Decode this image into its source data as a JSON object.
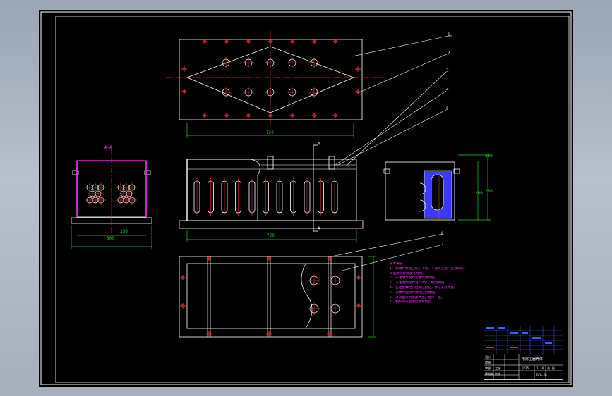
{
  "colors": {
    "background": "#a6b0bd",
    "sheet": "#000000",
    "border": "#ffffff",
    "geometry": "#ffffff",
    "center_lines": "#ff3333",
    "dimensions": "#25d025",
    "notes": "#ff30ff",
    "title_block": "#3b5cff"
  },
  "callouts": [
    "1",
    "2",
    "3",
    "4",
    "5",
    "6",
    "7"
  ],
  "section_marks": [
    "A",
    "A"
  ],
  "dimensions": {
    "top_plan_width": "720",
    "front_width": "720",
    "left_width": "300",
    "left_inner": "250",
    "side_heights": [
      "310",
      "280",
      "260"
    ]
  },
  "left_view_label": "A-A",
  "notes": {
    "heading": "技术要求",
    "lines": [
      "1. 焊接件焊缝应均匀平整，不得有夹渣气孔等缺陷。",
      "   焊后清除焊渣及飞溅物。",
      "2. 未注明焊缝均为连续角焊缝。",
      "3. 未注明倒角均为1×45°，锐边倒钝。",
      "4. 各连接螺栓孔位置应配钻，保证安装精度。",
      "5. 箱体焊后进行消除应力处理。",
      "6. 外表面涂防锈漆两遍，面漆一遍。",
      "7. 制作完成后进行渗漏试验。"
    ]
  },
  "title_block": {
    "drawing_title": "电除尘器壳体",
    "scale": "1:10",
    "material": "Q235",
    "sheet": "共1张",
    "rows": [
      "设计",
      "校核",
      "审核",
      "工艺",
      "标准化",
      "批准"
    ],
    "part_no": "DCQ-01"
  }
}
